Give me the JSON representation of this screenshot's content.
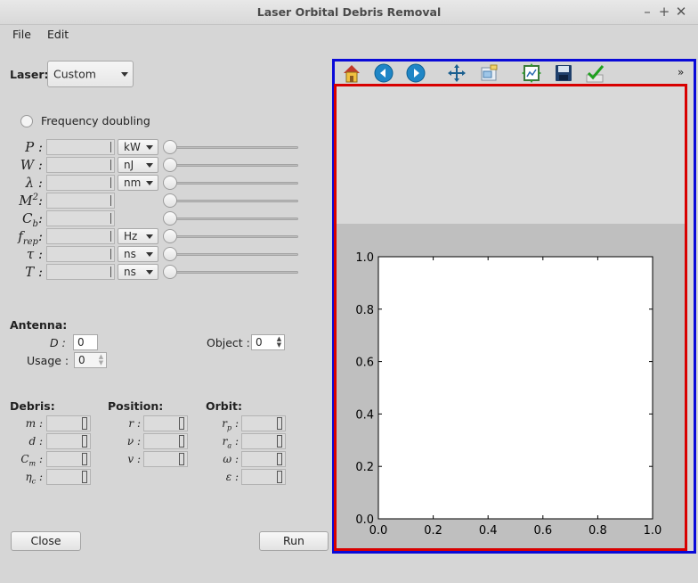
{
  "window": {
    "title": "Laser Orbital Debris Removal"
  },
  "menu": {
    "file": "File",
    "edit": "Edit"
  },
  "laser": {
    "label": "Laser:",
    "selected": "Custom"
  },
  "frequency_doubling": {
    "label": "Frequency doubling",
    "checked": false
  },
  "params": {
    "rows": [
      {
        "name": "P",
        "unit": "kW"
      },
      {
        "name": "W",
        "unit": "nJ"
      },
      {
        "name": "λ",
        "unit": "nm"
      },
      {
        "name": "M2",
        "unit": ""
      },
      {
        "name": "Cb",
        "unit": ""
      },
      {
        "name": "frep",
        "unit": "Hz"
      },
      {
        "name": "τ",
        "unit": "ns"
      },
      {
        "name": "T",
        "unit": "ns"
      }
    ],
    "units": {
      "p": "kW",
      "w": "nJ",
      "lambda": "nm",
      "frep": "Hz",
      "tau": "ns",
      "t": "ns"
    }
  },
  "antenna": {
    "title": "Antenna:",
    "d_label": "D :",
    "d_value": "0",
    "usage_label": "Usage :",
    "usage_value": "0",
    "object_label": "Object :",
    "object_value": "0"
  },
  "debris": {
    "title": "Debris:",
    "labels": [
      "m :",
      "d :",
      "Cm :",
      "ηc :"
    ]
  },
  "position": {
    "title": "Position:",
    "labels": [
      "r :",
      "ν :",
      "v :"
    ]
  },
  "orbit": {
    "title": "Orbit:",
    "labels": [
      "rp :",
      "ra :",
      "ω :",
      "ε :"
    ]
  },
  "buttons": {
    "close": "Close",
    "run": "Run"
  },
  "toolbar": {
    "icons": [
      "home-icon",
      "back-icon",
      "forward-icon",
      "pan-icon",
      "zoom-icon",
      "subplots-icon",
      "save-icon",
      "check-icon"
    ],
    "more": "»"
  },
  "chart_data": {
    "type": "line",
    "title": "",
    "xlabel": "",
    "ylabel": "",
    "xlim": [
      0.0,
      1.0
    ],
    "ylim": [
      0.0,
      1.0
    ],
    "xticks": [
      "0.0",
      "0.2",
      "0.4",
      "0.6",
      "0.8",
      "1.0"
    ],
    "yticks": [
      "0.0",
      "0.2",
      "0.4",
      "0.6",
      "0.8",
      "1.0"
    ],
    "series": []
  }
}
